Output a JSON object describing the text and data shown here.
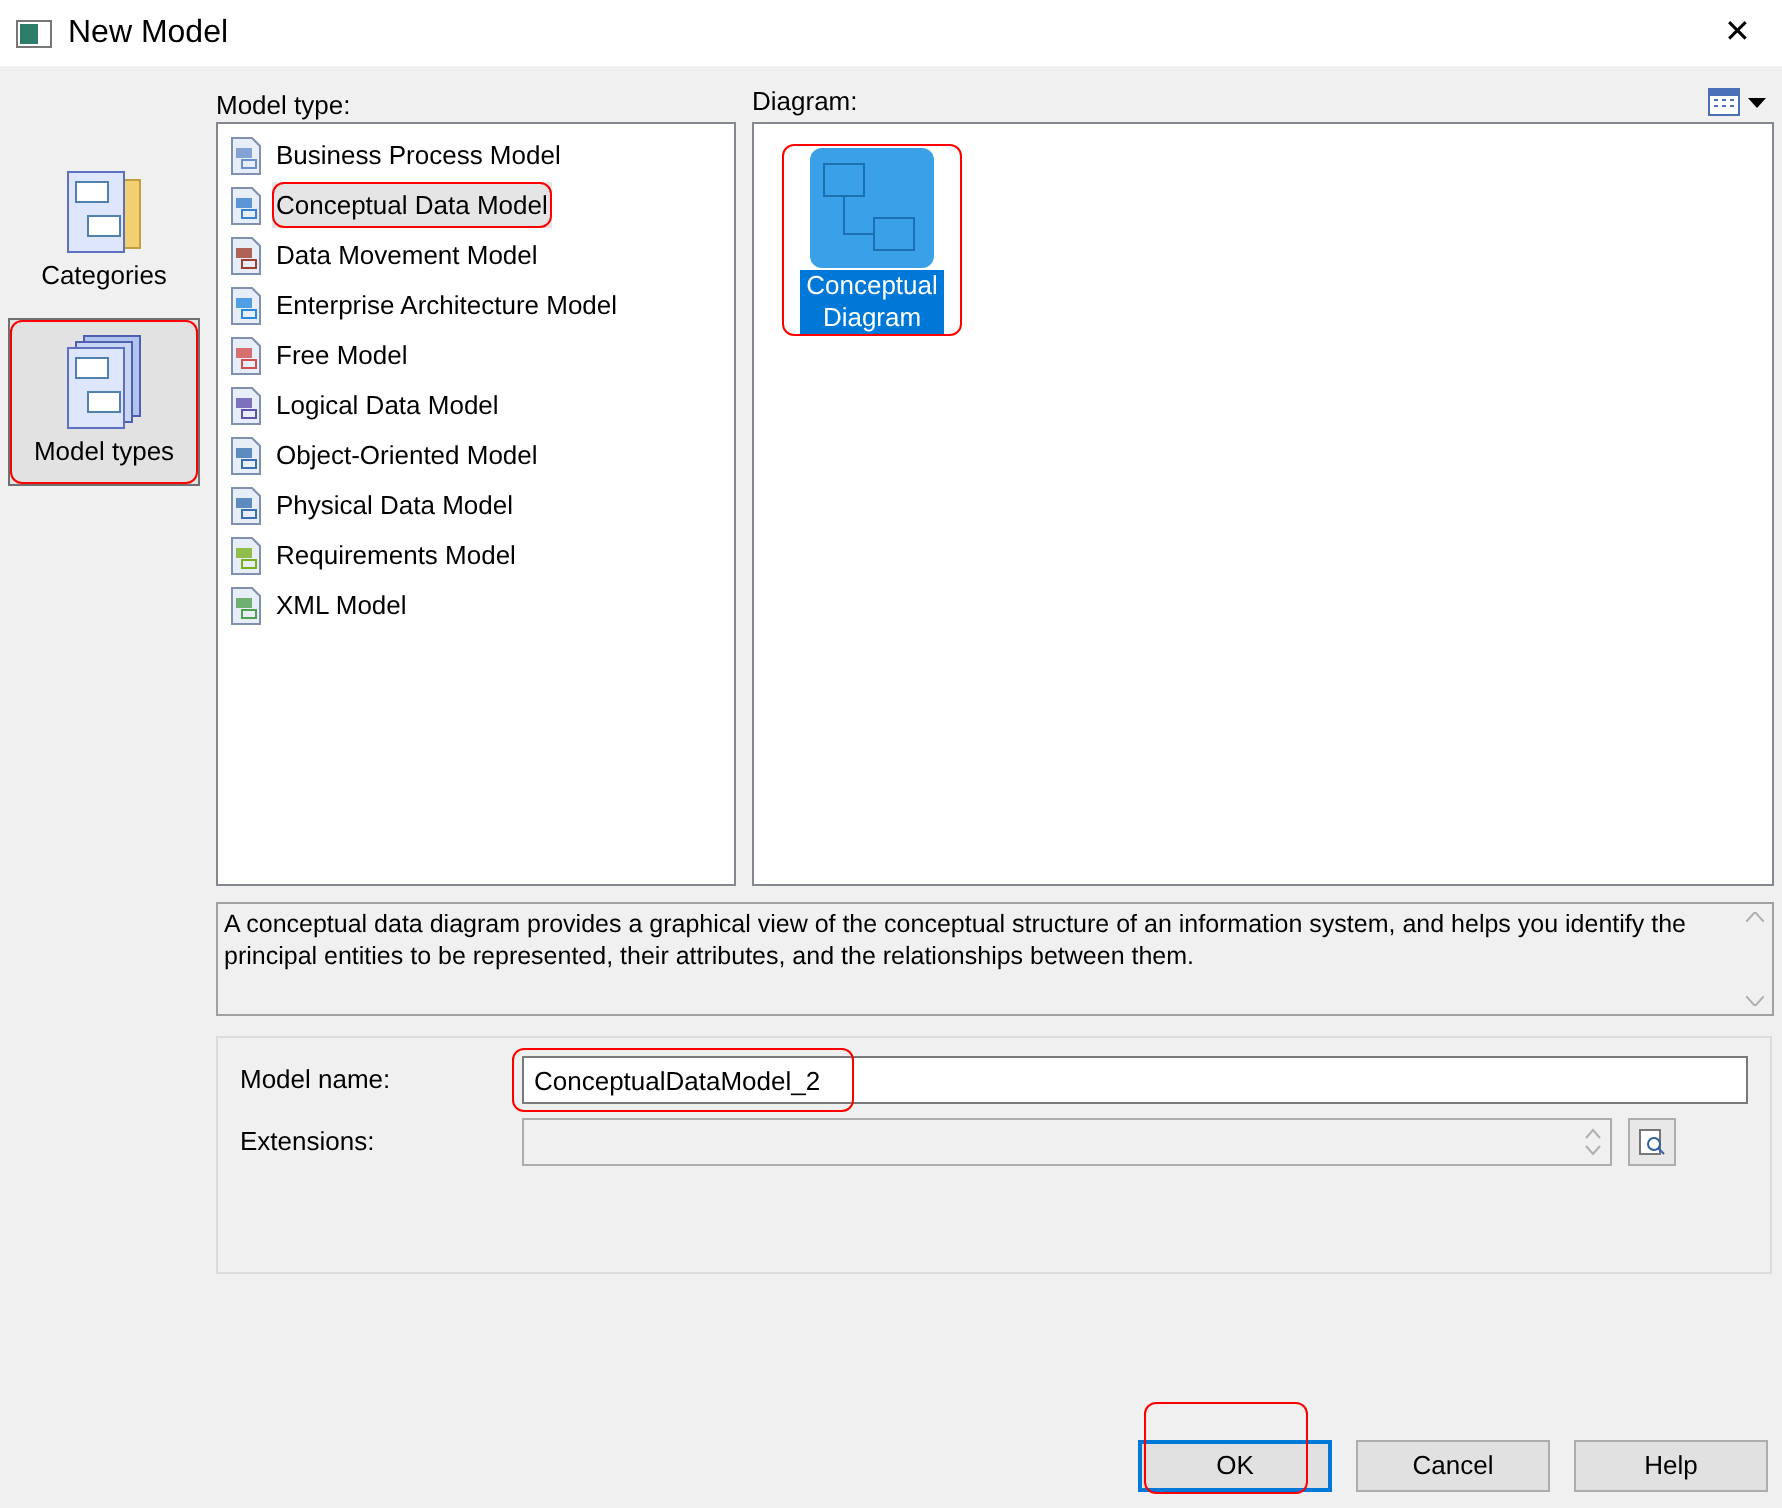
{
  "window": {
    "title": "New Model",
    "close": "✕"
  },
  "categories": [
    {
      "label": "Categories",
      "selected": false,
      "highlighted": false
    },
    {
      "label": "Model types",
      "selected": true,
      "highlighted": true
    }
  ],
  "model_type": {
    "label": "Model type:",
    "items": [
      {
        "label": "Business Process Model",
        "selected": false,
        "highlighted": false
      },
      {
        "label": "Conceptual Data Model",
        "selected": true,
        "highlighted": true
      },
      {
        "label": "Data Movement Model",
        "selected": false,
        "highlighted": false
      },
      {
        "label": "Enterprise Architecture Model",
        "selected": false,
        "highlighted": false
      },
      {
        "label": "Free Model",
        "selected": false,
        "highlighted": false
      },
      {
        "label": "Logical Data Model",
        "selected": false,
        "highlighted": false
      },
      {
        "label": "Object-Oriented Model",
        "selected": false,
        "highlighted": false
      },
      {
        "label": "Physical Data Model",
        "selected": false,
        "highlighted": false
      },
      {
        "label": "Requirements Model",
        "selected": false,
        "highlighted": false
      },
      {
        "label": "XML Model",
        "selected": false,
        "highlighted": false
      }
    ]
  },
  "diagram": {
    "label": "Diagram:",
    "items": [
      {
        "label": "Conceptual Diagram",
        "selected": true,
        "highlighted": true
      }
    ]
  },
  "description": "A conceptual data diagram provides a graphical view of the conceptual structure of an information system, and helps you identify the principal entities to be represented, their attributes, and the relationships between them.",
  "model_name": {
    "label": "Model name:",
    "value": "ConceptualDataModel_2",
    "highlighted": true
  },
  "extensions": {
    "label": "Extensions:",
    "disabled": true
  },
  "buttons": [
    {
      "label": "OK",
      "default": true,
      "highlighted": true
    },
    {
      "label": "Cancel",
      "default": false,
      "highlighted": false
    },
    {
      "label": "Help",
      "default": false,
      "highlighted": false
    }
  ]
}
